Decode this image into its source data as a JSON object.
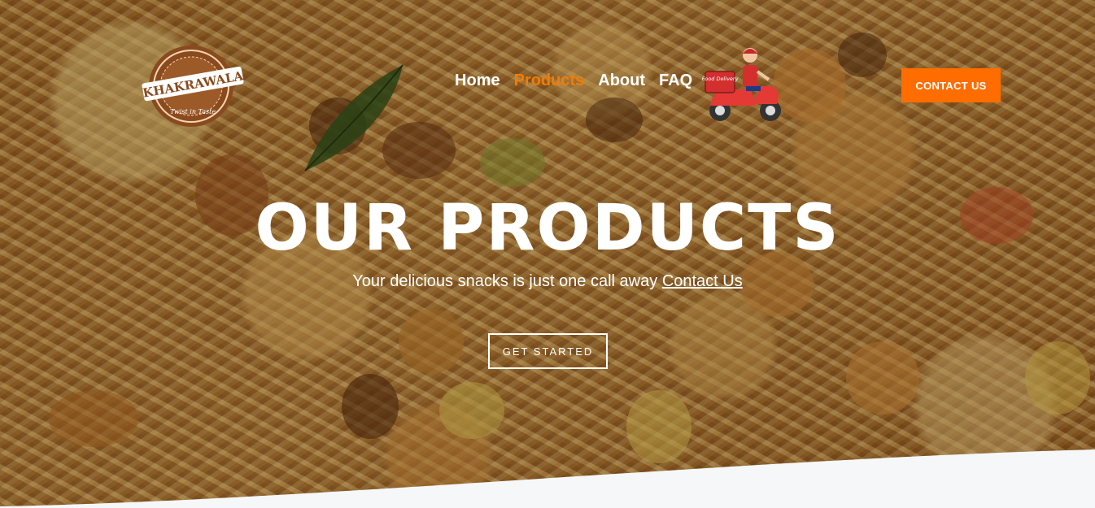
{
  "header": {
    "logo_name": "KHAKRAWALA",
    "logo_tagline": "Twist in Taste",
    "nav": [
      {
        "label": "Home",
        "active": false
      },
      {
        "label": "Products",
        "active": true
      },
      {
        "label": "About",
        "active": false
      },
      {
        "label": "FAQ",
        "active": false
      }
    ],
    "delivery_badge": "Food Delivery",
    "contact_button": "CONTACT US"
  },
  "hero": {
    "title": "OUR PRODUCTS",
    "subtitle": "Your delicious snacks is just one call away",
    "subtitle_link": "Contact Us",
    "cta_button": "GET STARTED"
  },
  "colors": {
    "accent": "#ff6d00",
    "active_nav": "#f57c00",
    "text": "#ffffff",
    "page_bg": "#f6f7f9"
  },
  "icons": [
    "khakrawala-logo",
    "delivery-scooter-icon"
  ]
}
